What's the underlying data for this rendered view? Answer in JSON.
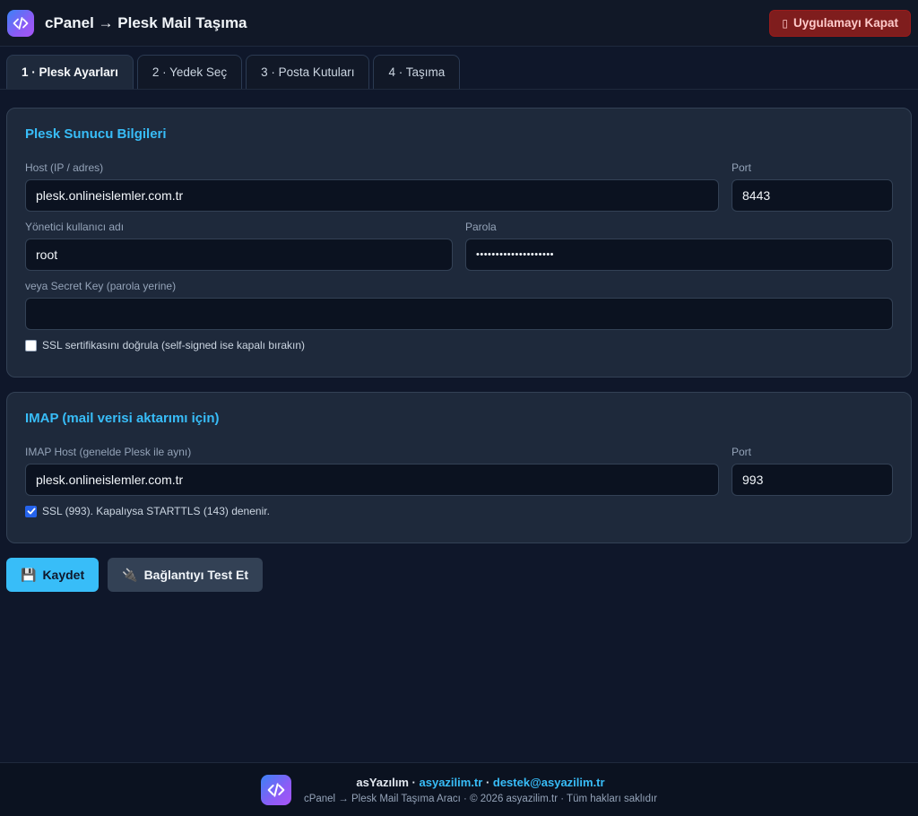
{
  "header": {
    "title": "cPanel → Plesk Mail Taşıma",
    "close_label": "Uygulamayı Kapat",
    "close_glyph": "▯"
  },
  "tabs": [
    {
      "label": "1 · Plesk Ayarları",
      "active": true
    },
    {
      "label": "2 · Yedek Seç",
      "active": false
    },
    {
      "label": "3 · Posta Kutuları",
      "active": false
    },
    {
      "label": "4 · Taşıma",
      "active": false
    }
  ],
  "plesk": {
    "title": "Plesk Sunucu Bilgileri",
    "host_label": "Host (IP / adres)",
    "host_value": "plesk.onlineislemler.com.tr",
    "port_label": "Port",
    "port_value": "8443",
    "user_label": "Yönetici kullanıcı adı",
    "user_value": "root",
    "password_label": "Parola",
    "password_value": "••••••••••••••••••••",
    "secret_label": "veya Secret Key (parola yerine)",
    "secret_value": "",
    "ssl_label": "SSL sertifikasını doğrula (self-signed ise kapalı bırakın)",
    "ssl_checked": false
  },
  "imap": {
    "title": "IMAP (mail verisi aktarımı için)",
    "host_label": "IMAP Host (genelde Plesk ile aynı)",
    "host_value": "plesk.onlineislemler.com.tr",
    "port_label": "Port",
    "port_value": "993",
    "ssl_label": "SSL (993). Kapalıysa STARTTLS (143) denenir.",
    "ssl_checked": true
  },
  "actions": {
    "save_icon": "💾",
    "save_label": "Kaydet",
    "test_icon": "🔌",
    "test_label": "Bağlantıyı Test Et"
  },
  "footer": {
    "brand": "asYazılım",
    "sep1": " · ",
    "site": "asyazilim.tr",
    "sep2": " · ",
    "email": "destek@asyazilim.tr",
    "copyright": "cPanel → Plesk Mail Taşıma Aracı · © 2026 asyazilim.tr · Tüm hakları saklıdır"
  },
  "colors": {
    "background": "#0f172a",
    "card": "#1e293b",
    "accent": "#38bdf8",
    "danger": "#7f1d1d"
  }
}
